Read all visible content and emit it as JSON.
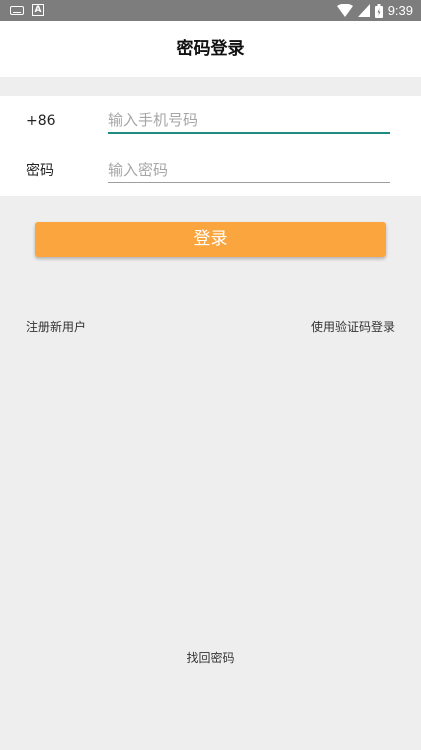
{
  "status_bar": {
    "time": "9:39",
    "left_icons": [
      "keyboard-icon",
      "a-icon"
    ],
    "right_icons": [
      "wifi-icon",
      "signal-icon",
      "battery-icon"
    ],
    "a_label": "A",
    "background": "#7d7d7d"
  },
  "header": {
    "title": "密码登录"
  },
  "form": {
    "phone_prefix": "+86",
    "phone_placeholder": "输入手机号码",
    "phone_value": "",
    "password_label": "密码",
    "password_placeholder": "输入密码",
    "password_value": ""
  },
  "actions": {
    "login_label": "登录",
    "register_label": "注册新用户",
    "sms_login_label": "使用验证码登录",
    "forgot_label": "找回密码"
  },
  "colors": {
    "accent": "#fba53f",
    "focus_underline": "#1f8c80",
    "background": "#eeeeee"
  }
}
